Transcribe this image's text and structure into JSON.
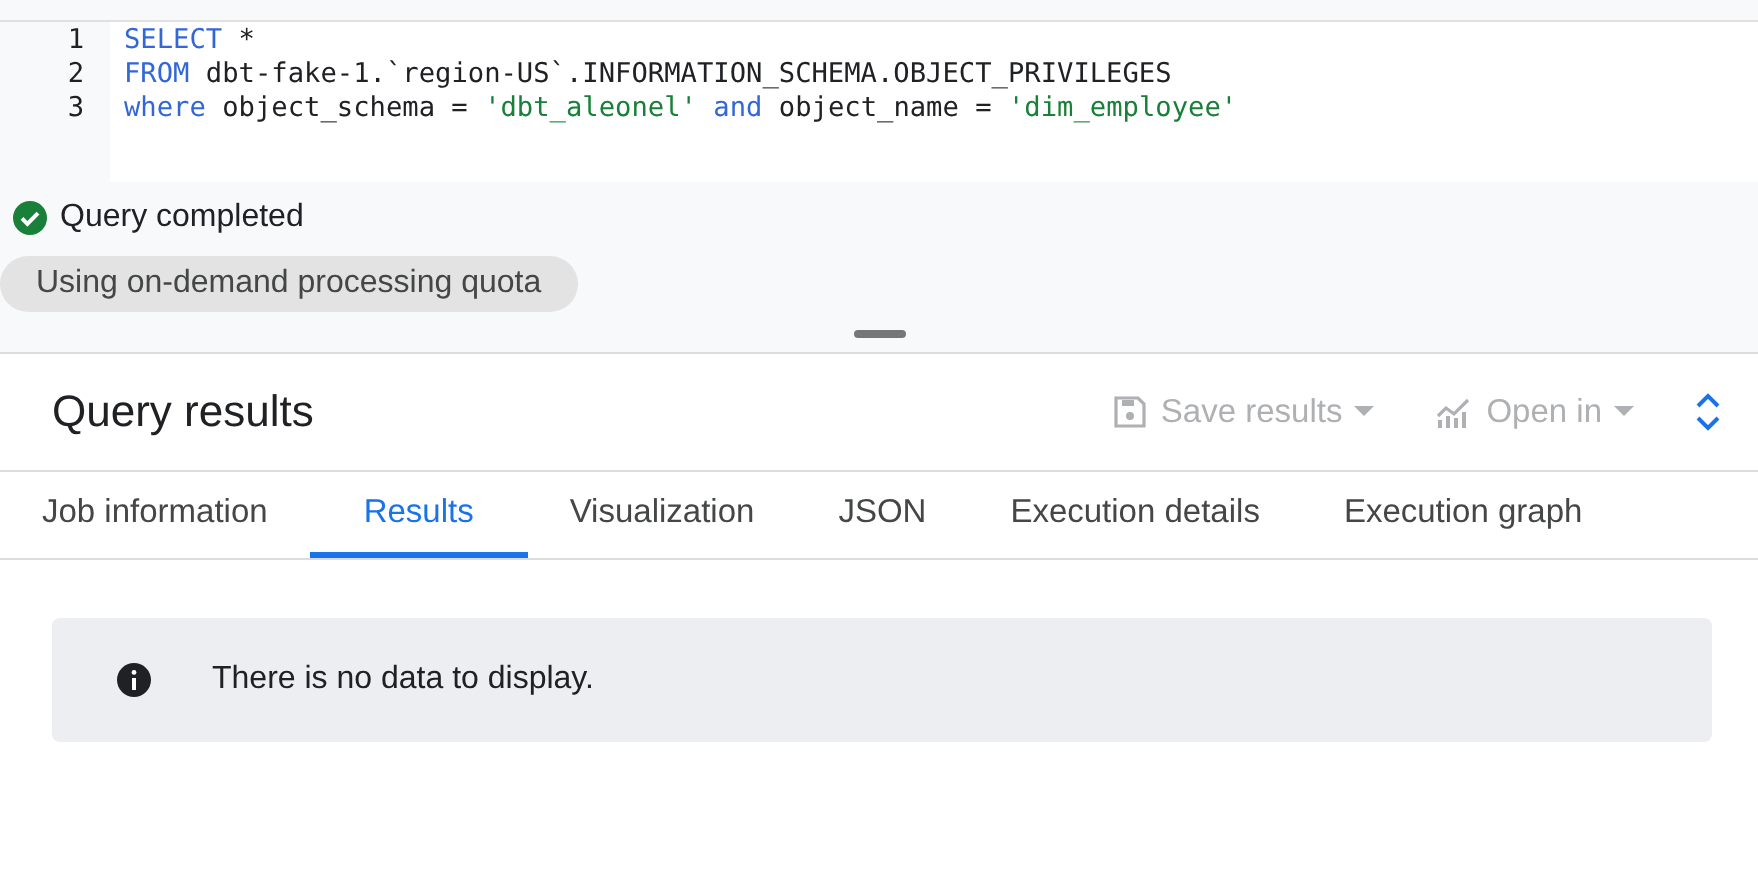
{
  "editor": {
    "lines": [
      {
        "number": "1",
        "tokens": [
          {
            "kind": "keyword",
            "text": "SELECT"
          },
          {
            "kind": "plain",
            "text": " *"
          }
        ]
      },
      {
        "number": "2",
        "tokens": [
          {
            "kind": "keyword",
            "text": "FROM"
          },
          {
            "kind": "plain",
            "text": " dbt-fake-1.`region-US`.INFORMATION_SCHEMA.OBJECT_PRIVILEGES"
          }
        ]
      },
      {
        "number": "3",
        "tokens": [
          {
            "kind": "keyword",
            "text": "where"
          },
          {
            "kind": "plain",
            "text": " object_schema = "
          },
          {
            "kind": "string",
            "text": "'dbt_aleonel'"
          },
          {
            "kind": "keyword",
            "text": " and"
          },
          {
            "kind": "plain",
            "text": " object_name = "
          },
          {
            "kind": "string",
            "text": "'dim_employee'"
          }
        ]
      }
    ]
  },
  "status": {
    "text": "Query completed",
    "chip": "Using on-demand processing quota"
  },
  "results": {
    "title": "Query results",
    "actions": [
      {
        "kind": "save",
        "label": "Save results",
        "disabled": true
      },
      {
        "kind": "chart",
        "label": "Open in",
        "disabled": true
      }
    ],
    "tabs": [
      {
        "label": "Job information",
        "selected": false
      },
      {
        "label": "Results",
        "selected": true
      },
      {
        "label": "Visualization",
        "selected": false
      },
      {
        "label": "JSON",
        "selected": false
      },
      {
        "label": "Execution details",
        "selected": false
      },
      {
        "label": "Execution graph",
        "selected": false
      }
    ],
    "message": "There is no data to display."
  }
}
